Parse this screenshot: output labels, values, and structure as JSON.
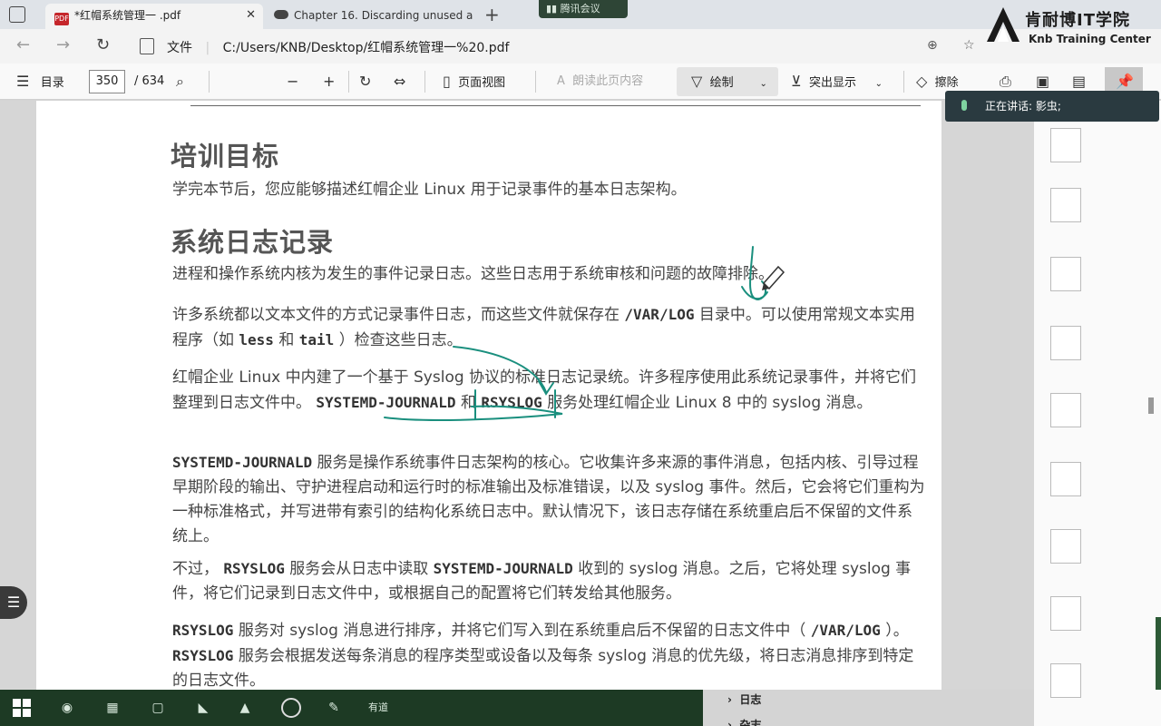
{
  "tabs": [
    {
      "title": "*红帽系统管理一 .pdf",
      "active": true
    },
    {
      "title": "Chapter 16. Discarding unused a",
      "active": false
    }
  ],
  "meeting_badge": "腾讯会议",
  "address": {
    "file_label": "文件",
    "path": "C:/Users/KNB/Desktop/红帽系统管理一%20.pdf"
  },
  "logo": {
    "cn": "肯耐博IT学院",
    "en": "Knb Training Center"
  },
  "toolbar": {
    "toc_label": "目录",
    "page_current": "350",
    "page_total": "/ 634",
    "page_view_label": "页面视图",
    "read_aloud_label": "朗读此页内容",
    "draw_label": "绘制",
    "highlight_label": "突出显示",
    "erase_label": "擦除"
  },
  "speaker": {
    "text": "正在讲话: 影虫;"
  },
  "document": {
    "heading1": "培训目标",
    "para_goal": "学完本节后，您应能够描述红帽企业 Linux 用于记录事件的基本日志架构。",
    "heading2": "系统日志记录",
    "para1": "进程和操作系统内核为发生的事件记录日志。这些日志用于系统审核和问题的故障排除。",
    "para2_a": "许多系统都以文本文件的方式记录事件日志，而这些文件就保存在",
    "para2_code1": "/VAR/LOG",
    "para2_b": "目录中。可以使用常规文本实用程序（如",
    "para2_code2": "less",
    "para2_c": "和",
    "para2_code3": "tail",
    "para2_d": "）检查这些日志。",
    "para3_a": "红帽企业 Linux 中内建了一个基于 Syslog 协议的标准日志记录统。许多程序使用此系统记录事件，并将它们整理到日志文件中。",
    "para3_code1": "SYSTEMD-JOURNALD",
    "para3_b": "和",
    "para3_code2": "RSYSLOG",
    "para3_c": "服务处理红帽企业 Linux 8 中的 syslog 消息。",
    "para4_code": "SYSTEMD-JOURNALD",
    "para4_text": "服务是操作系统事件日志架构的核心。它收集许多来源的事件消息，包括内核、引导过程早期阶段的输出、守护进程启动和运行时的标准输出及标准错误，以及 syslog 事件。然后，它会将它们重构为一种标准格式，并写进带有索引的结构化系统日志中。默认情况下，该日志存储在系统重启后不保留的文件系统上。",
    "para5_a": "不过，",
    "para5_code1": "RSYSLOG",
    "para5_b": "服务会从日志中读取",
    "para5_code2": "SYSTEMD-JOURNALD",
    "para5_c": "收到的 syslog 消息。之后，它将处理 syslog 事件，将它们记录到日志文件中，或根据自己的配置将它们转发给其他服务。",
    "para6_code1": "RSYSLOG",
    "para6_a": "服务对 syslog 消息进行排序，并将它们写入到在系统重启后不保留的日志文件中（",
    "para6_code2": "/VAR/LOG",
    "para6_b": "）。",
    "para6_code3": "RSYSLOG",
    "para6_c": "服务会根据发送每条消息的程序类型或设备以及每条 syslog 消息的优先级，将日志消息排序到特定的日志文件。"
  },
  "outline": {
    "item1": "日志",
    "item2": "杂志"
  },
  "taskbar": {
    "app_label": "有道"
  },
  "colors": {
    "annotation": "#1a8f7e",
    "taskbar": "#1d3a24"
  }
}
